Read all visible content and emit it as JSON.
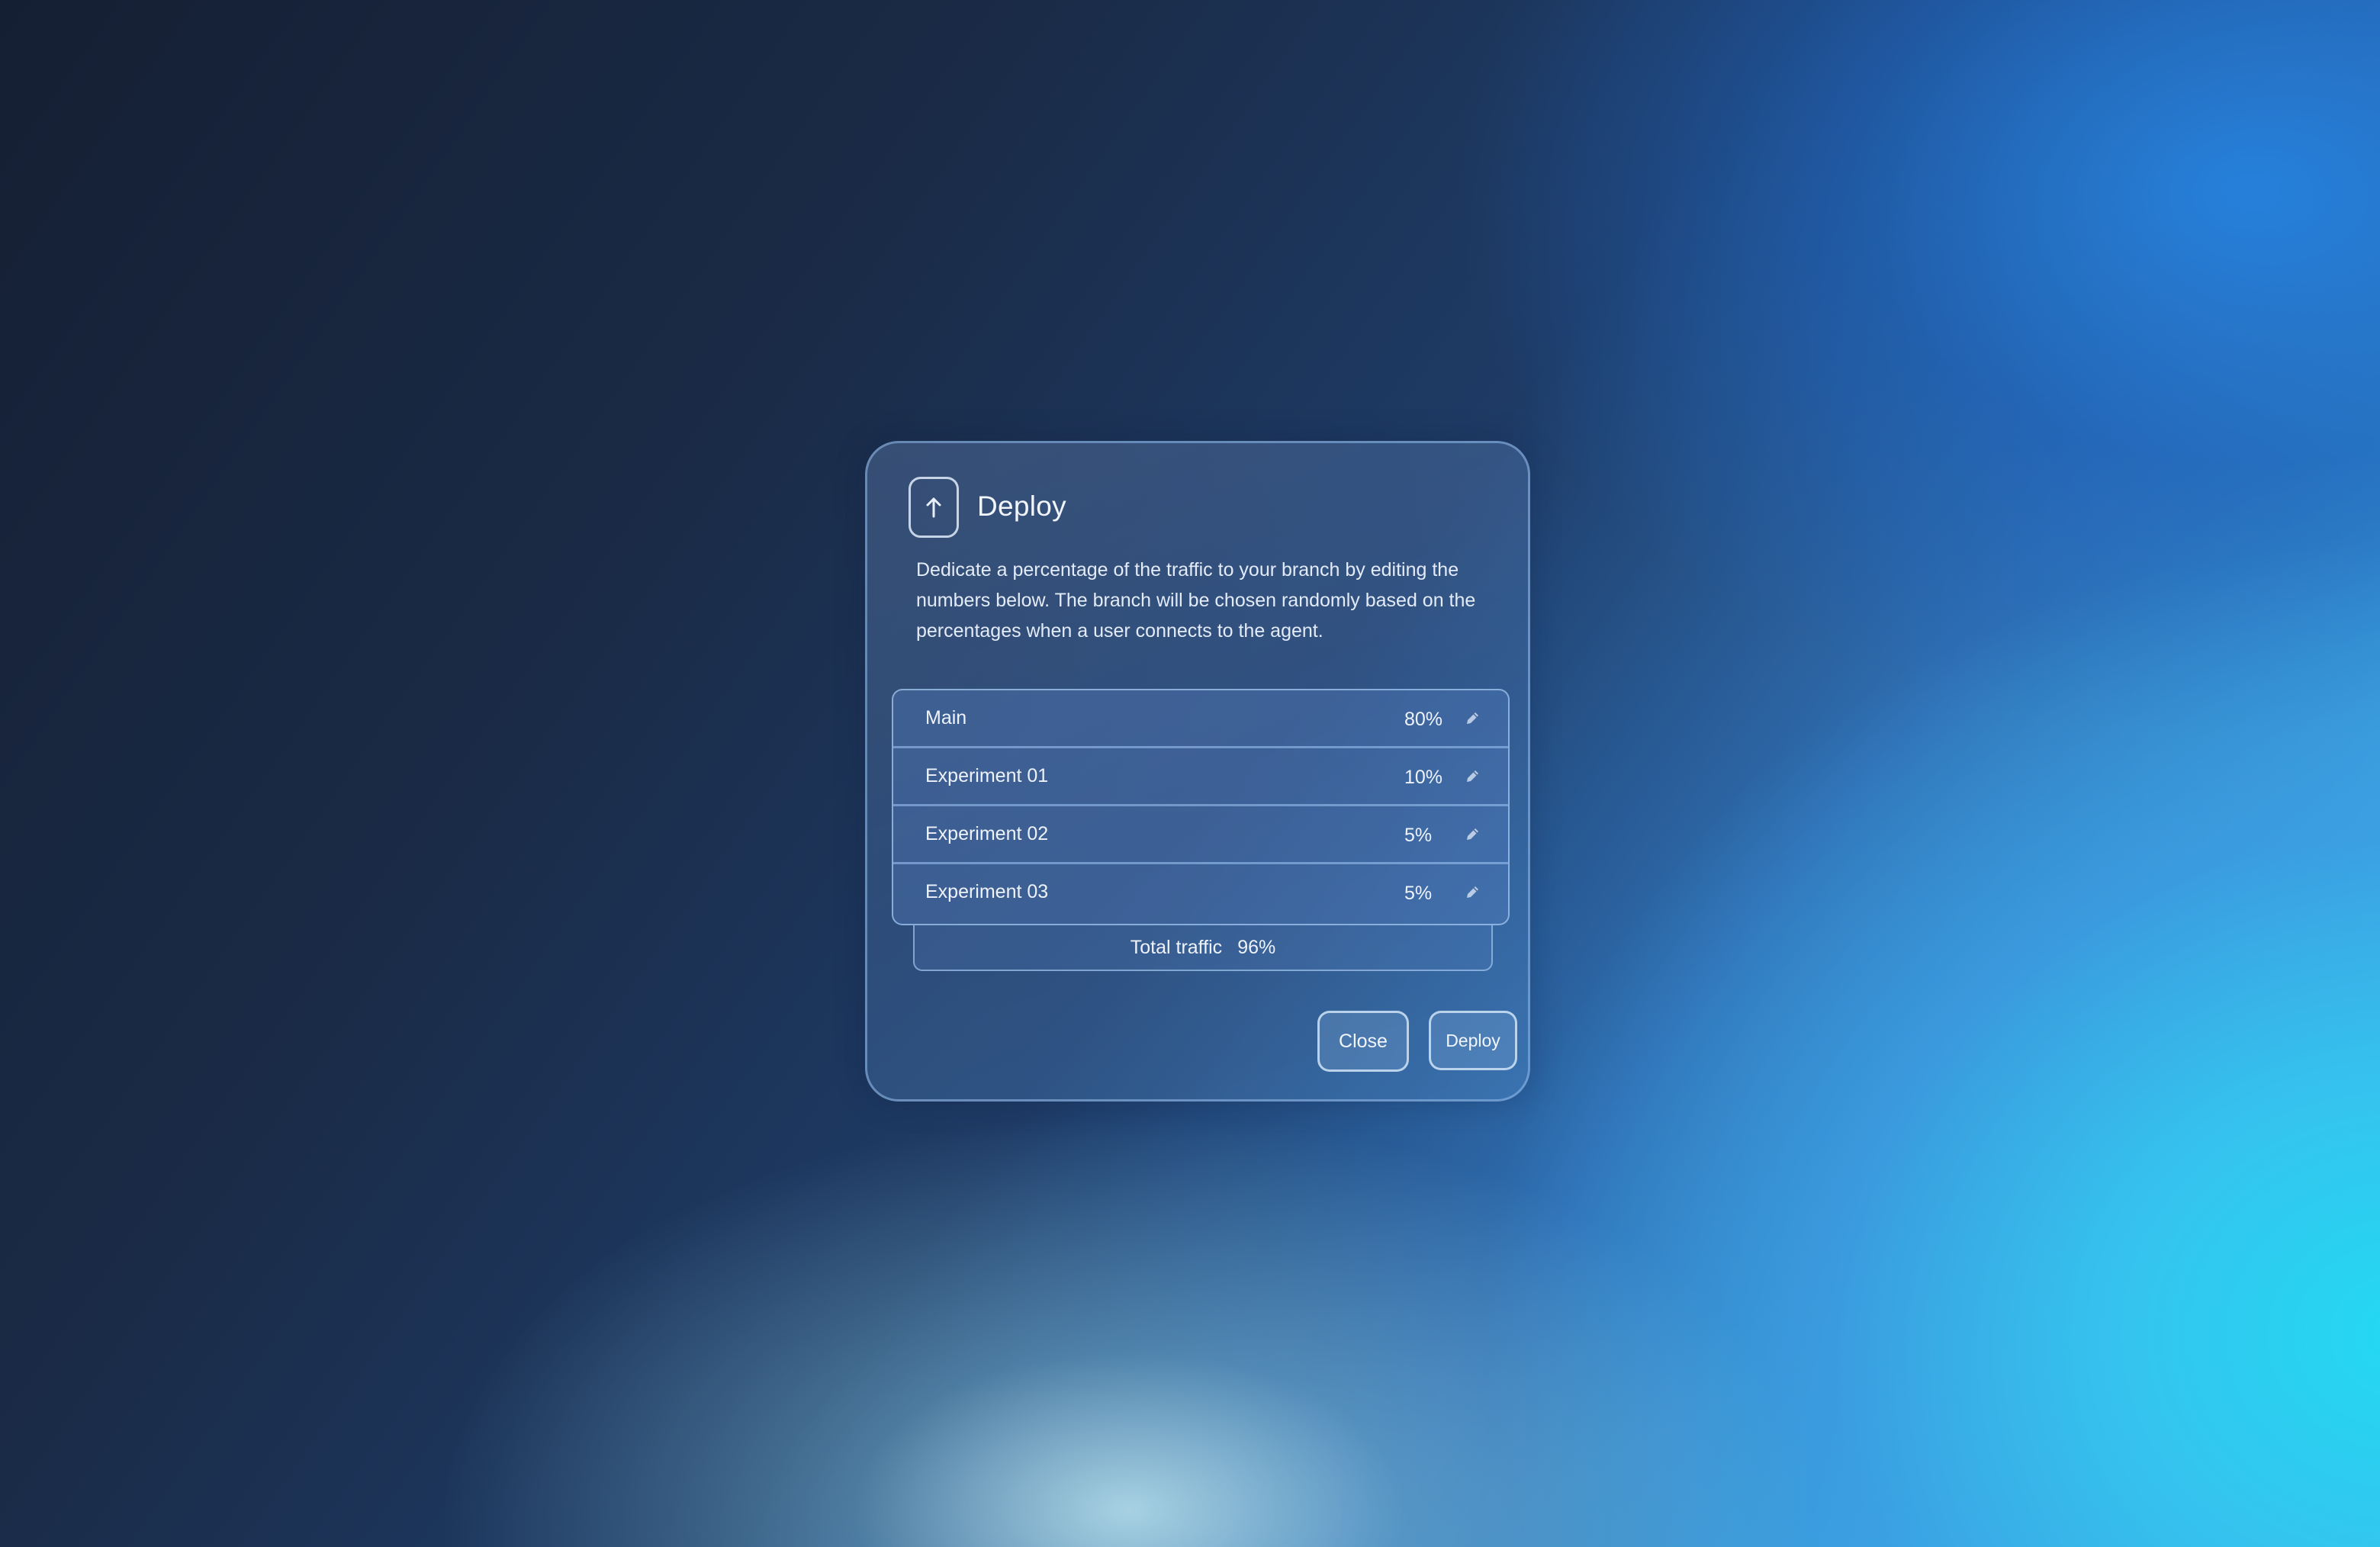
{
  "dialog": {
    "title": "Deploy",
    "icon": "arrow-up-icon",
    "description": "Dedicate a percentage of the traffic to your branch by editing the numbers below. The branch will be chosen randomly based on the percentages when a user connects to the agent."
  },
  "branches": [
    {
      "name": "Main",
      "percentage": "80%"
    },
    {
      "name": "Experiment 01",
      "percentage": "10%"
    },
    {
      "name": "Experiment 02",
      "percentage": "5%"
    },
    {
      "name": "Experiment 03",
      "percentage": "5%"
    }
  ],
  "total": {
    "label": "Total traffic",
    "value": "96%"
  },
  "actions": {
    "close_label": "Close",
    "deploy_label": "Deploy"
  },
  "icons": {
    "edit": "pencil-icon"
  },
  "colors": {
    "background_dark": "#151f33",
    "background_accent": "#28d2f0",
    "dialog_border": "#96bee9",
    "text": "#eef3fb"
  }
}
